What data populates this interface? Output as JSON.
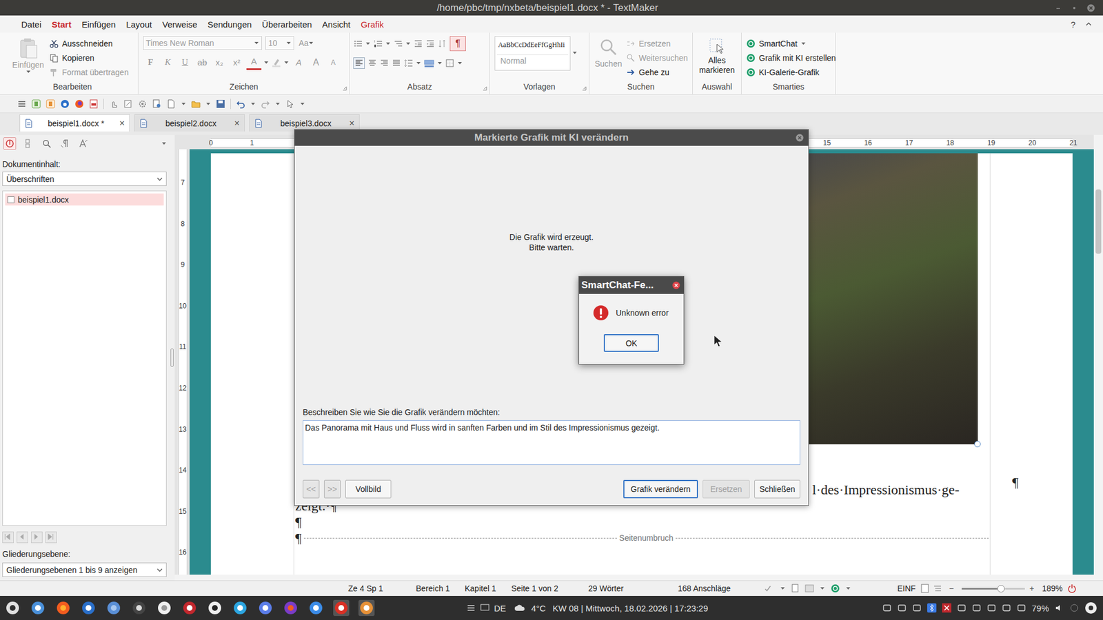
{
  "window": {
    "title": "/home/pbc/tmp/nxbeta/beispiel1.docx * - TextMaker"
  },
  "menu": {
    "items": [
      {
        "label": "Datei",
        "selected": false,
        "kind": "normal"
      },
      {
        "label": "Start",
        "selected": true,
        "kind": "normal"
      },
      {
        "label": "Einfügen",
        "selected": false,
        "kind": "normal"
      },
      {
        "label": "Layout",
        "selected": false,
        "kind": "normal"
      },
      {
        "label": "Verweise",
        "selected": false,
        "kind": "normal"
      },
      {
        "label": "Sendungen",
        "selected": false,
        "kind": "normal"
      },
      {
        "label": "Überarbeiten",
        "selected": false,
        "kind": "normal"
      },
      {
        "label": "Ansicht",
        "selected": false,
        "kind": "normal"
      },
      {
        "label": "Grafik",
        "selected": false,
        "kind": "context"
      }
    ],
    "help": "?"
  },
  "ribbon": {
    "edit": {
      "label": "Bearbeiten",
      "paste": {
        "label": "Einfügen",
        "disabled": true
      },
      "items": [
        {
          "label": "Ausschneiden",
          "disabled": false
        },
        {
          "label": "Kopieren",
          "disabled": false
        },
        {
          "label": "Format übertragen",
          "disabled": true
        }
      ]
    },
    "font": {
      "label": "Zeichen",
      "family": "Times New Roman",
      "size": "10",
      "case": "Aa",
      "buttons": [
        {
          "label": "F",
          "kind": "bold"
        },
        {
          "label": "K",
          "kind": "italic"
        },
        {
          "label": "U",
          "kind": "underline"
        },
        {
          "label": "ab",
          "kind": "strike"
        },
        {
          "label": "x₂",
          "kind": "plain"
        },
        {
          "label": "x²",
          "kind": "plain"
        },
        {
          "label": "A",
          "kind": "color"
        }
      ],
      "extra": [
        {
          "label": "A",
          "kind": "clear"
        },
        {
          "label": "A",
          "kind": "grow"
        },
        {
          "label": "A",
          "kind": "shrink"
        }
      ]
    },
    "paragraph": {
      "label": "Absatz",
      "marks": "¶",
      "marks_on": true
    },
    "styles": {
      "label": "Vorlagen",
      "preview": "AaBbCcDdEeFfGgHhIi",
      "style": "Normal"
    },
    "search": {
      "label": "Suchen",
      "button": {
        "label": "Suchen",
        "disabled": true
      },
      "items": [
        {
          "label": "Ersetzen",
          "disabled": true
        },
        {
          "label": "Weitersuchen",
          "disabled": true
        },
        {
          "label": "Gehe zu",
          "disabled": false
        }
      ]
    },
    "selection": {
      "label": "Auswahl",
      "button": "Alles markieren"
    },
    "smarties": {
      "label": "Smarties",
      "items": [
        "SmartChat",
        "Grafik mit KI erstellen",
        "KI-Galerie-Grafik"
      ]
    }
  },
  "doc_tabs": [
    {
      "label": "beispiel1.docx *",
      "selected": true,
      "close": "×"
    },
    {
      "label": "beispiel2.docx",
      "selected": false,
      "close": "×"
    },
    {
      "label": "beispiel3.docx",
      "selected": false,
      "close": "×"
    }
  ],
  "sidebar": {
    "tools": [
      {
        "selected": true
      },
      {
        "selected": false
      },
      {
        "selected": false
      },
      {
        "selected": false
      },
      {
        "selected": false
      }
    ],
    "content_label": "Dokumentinhalt:",
    "content_select": "Überschriften",
    "tree": [
      {
        "label": "beispiel1.docx",
        "checked": false,
        "selected": true
      }
    ],
    "level_label": "Gliederungsebene:",
    "level_select": "Gliederungsebenen 1 bis 9 anzeigen"
  },
  "document": {
    "ruler_h": [
      "0",
      "1",
      "15",
      "16",
      "17",
      "18",
      "19",
      "20",
      "21"
    ],
    "ruler_v": [
      "7",
      "8",
      "9",
      "10",
      "11",
      "12",
      "13",
      "14",
      "15",
      "16"
    ],
    "photo_mark": "¶",
    "lines": [
      "l·des·Impressionismus·ge-",
      "zeigt.·¶"
    ],
    "blank_mark": "¶",
    "break_mark": "¶",
    "page_break": "Seitenumbruch"
  },
  "dialog": {
    "title": "Markierte Grafik mit KI verändern",
    "status": [
      "Die Grafik wird erzeugt.",
      "Bitte warten."
    ],
    "prompt_label": "Beschreiben Sie wie Sie die Grafik verändern möchten:",
    "prompt": "Das Panorama mit Haus und Fluss wird in sanften Farben und im Stil des Impressionismus gezeigt.",
    "nav_buttons": [
      {
        "label": "<<",
        "disabled": true
      },
      {
        "label": ">>",
        "disabled": true
      },
      {
        "label": "Vollbild",
        "disabled": false
      }
    ],
    "buttons": [
      {
        "label": "Grafik verändern",
        "disabled": false,
        "focused": true
      },
      {
        "label": "Ersetzen",
        "disabled": true,
        "focused": false
      },
      {
        "label": "Schließen",
        "disabled": false,
        "focused": false
      }
    ]
  },
  "error_dialog": {
    "title": "SmartChat-Fe...",
    "message": "Unknown error",
    "button": "OK"
  },
  "status_bar": {
    "items": [
      "Ze 4 Sp 1",
      "Bereich 1",
      "Kapitel 1",
      "Seite 1 von 2",
      "29 Wörter",
      "168 Anschläge"
    ],
    "mode": "EINF",
    "minus": "−",
    "plus": "+",
    "zoom_level": 0.62,
    "zoom": "189%"
  },
  "taskbar": {
    "lang": "DE",
    "weather": "4°C",
    "clock": "KW 08 | Mittwoch, 18.02.2026 | 17:23:29",
    "battery": "79%"
  }
}
